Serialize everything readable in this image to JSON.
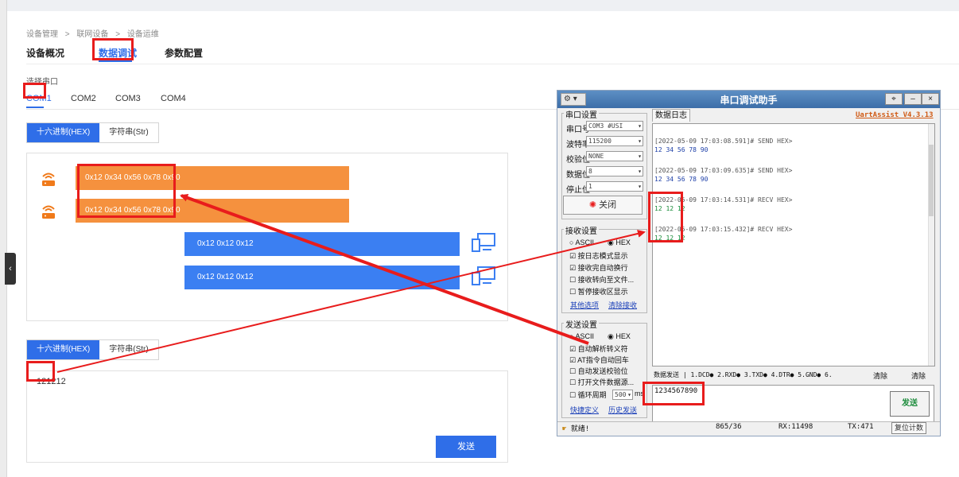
{
  "breadcrumb": [
    "设备管理",
    ">",
    "联网设备",
    ">",
    "设备运维"
  ],
  "tabs": {
    "overview": "设备概况",
    "debug": "数据调试",
    "params": "参数配置"
  },
  "port_section": {
    "label": "选择串口",
    "ports": [
      "COM1",
      "COM2",
      "COM3",
      "COM4"
    ]
  },
  "format_toggle": {
    "hex": "十六进制(HEX)",
    "str": "字符串(Str)"
  },
  "messages": {
    "sent": [
      "0x12 0x34 0x56 0x78 0x90",
      "0x12 0x34 0x56 0x78 0x90"
    ],
    "received": [
      "0x12 0x12 0x12",
      "0x12 0x12 0x12"
    ]
  },
  "send_panel": {
    "value": "121212",
    "button": "发送"
  },
  "assistant": {
    "title": "串口调试助手",
    "menu": "⚙ ▾",
    "version": "UartAssist V4.3.13",
    "port_group": "串口设置",
    "fields": [
      {
        "label": "串口号",
        "value": "COM3 #USI"
      },
      {
        "label": "波特率",
        "value": "115200"
      },
      {
        "label": "校验位",
        "value": "NONE"
      },
      {
        "label": "数据位",
        "value": "8"
      },
      {
        "label": "停止位",
        "value": "1"
      }
    ],
    "close_button": "关闭",
    "recv_group": "接收设置",
    "recv_mode": {
      "ascii": "ASCII",
      "hex": "HEX"
    },
    "recv_options": [
      "按日志模式显示",
      "接收完自动换行",
      "接收转向至文件...",
      "暂停接收区显示"
    ],
    "recv_links": {
      "more": "其他选项",
      "clear": "清除接收"
    },
    "send_group": "发送设置",
    "send_mode": {
      "ascii": "ASCII",
      "hex": "HEX"
    },
    "send_options": [
      "自动解析转义符",
      "AT指令自动回车",
      "自动发送校验位",
      "打开文件数据源..."
    ],
    "cycle_label": "循环周期",
    "cycle_value": "500",
    "cycle_unit": "ms",
    "send_links": {
      "shortcut": "快捷定义",
      "history": "历史发送"
    },
    "log_tab": "数据日志",
    "log": [
      {
        "ts": "[2022-05-09 17:03:08.591]# SEND HEX>",
        "data": "12 34 56 78 90",
        "kind": "send"
      },
      {
        "ts": "[2022-05-09 17:03:09.635]# SEND HEX>",
        "data": "12 34 56 78 90",
        "kind": "send"
      },
      {
        "ts": "[2022-05-09 17:03:14.531]# RECV HEX>",
        "data": "12 12 12",
        "kind": "recv"
      },
      {
        "ts": "[2022-05-09 17:03:15.432]# RECV HEX>",
        "data": "12 12 12",
        "kind": "recv"
      }
    ],
    "signal_strip": "数据发送 | 1.DCD● 2.RXD● 3.TXD● 4.DTR● 5.GND● 6.",
    "clear_send": "清除",
    "clear_all": "清除",
    "send_value": "1234567890",
    "send_button": "发送",
    "status": {
      "ready": "就绪!",
      "counter": "865/36",
      "rx": "RX:11498",
      "tx": "TX:471",
      "reset": "复位计数"
    }
  },
  "colors": {
    "primary": "#2f6ee8",
    "orange": "#f5913e",
    "blue_bar": "#3b7ff2",
    "annotation": "#e81c1c"
  }
}
